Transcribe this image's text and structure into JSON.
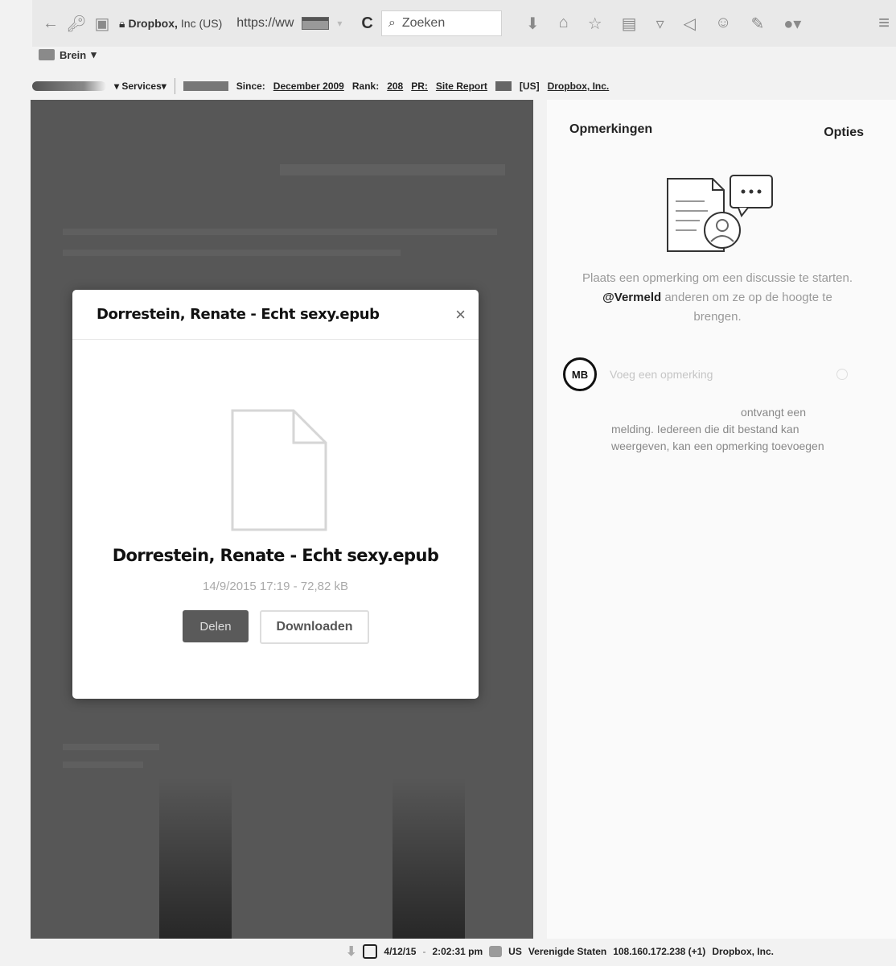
{
  "browser": {
    "site_identity": "Dropbox, Inc (US)",
    "site_org": "Dropbox,",
    "site_country": "Inc (US)",
    "url": "https://ww",
    "search_placeholder": "Zoeken",
    "bookmark_folder": "Brein",
    "bookmark_caret": "▾"
  },
  "addon_bar": {
    "services": "Services",
    "since_label": "Since:",
    "since_value": "December 2009",
    "rank_label": "Rank:",
    "rank_value": "208",
    "pr_label": "PR:",
    "site_report": "Site Report",
    "country": "[US]",
    "company": "Dropbox, Inc."
  },
  "modal": {
    "title": "Dorrestein, Renate - Echt sexy.epub",
    "close": "×",
    "file_name": "Dorrestein, Renate - Echt sexy.epub",
    "file_meta": "14/9/2015 17:19 - 72,82 kB",
    "share_label": "Delen",
    "download_label": "Downloaden"
  },
  "comments": {
    "title": "Opmerkingen",
    "options": "Opties",
    "empty_before": "Plaats een opmerking om een discussie te starten. ",
    "empty_mention": "@Vermeld",
    "empty_after": " anderen om ze op de hoogte te brengen.",
    "avatar_initials": "MB",
    "input_placeholder": "Voeg een opmerking",
    "notice_line1": "ontvangt een",
    "notice_rest": "melding. Iedereen die dit bestand kan weergeven, kan een opmerking toevoegen"
  },
  "status_bar": {
    "date": "4/12/15",
    "time": "2:02:31 pm",
    "country_code": "US",
    "country_name": "Verenigde Staten",
    "ip": "108.160.172.238 (+1)",
    "company": "Dropbox, Inc."
  }
}
